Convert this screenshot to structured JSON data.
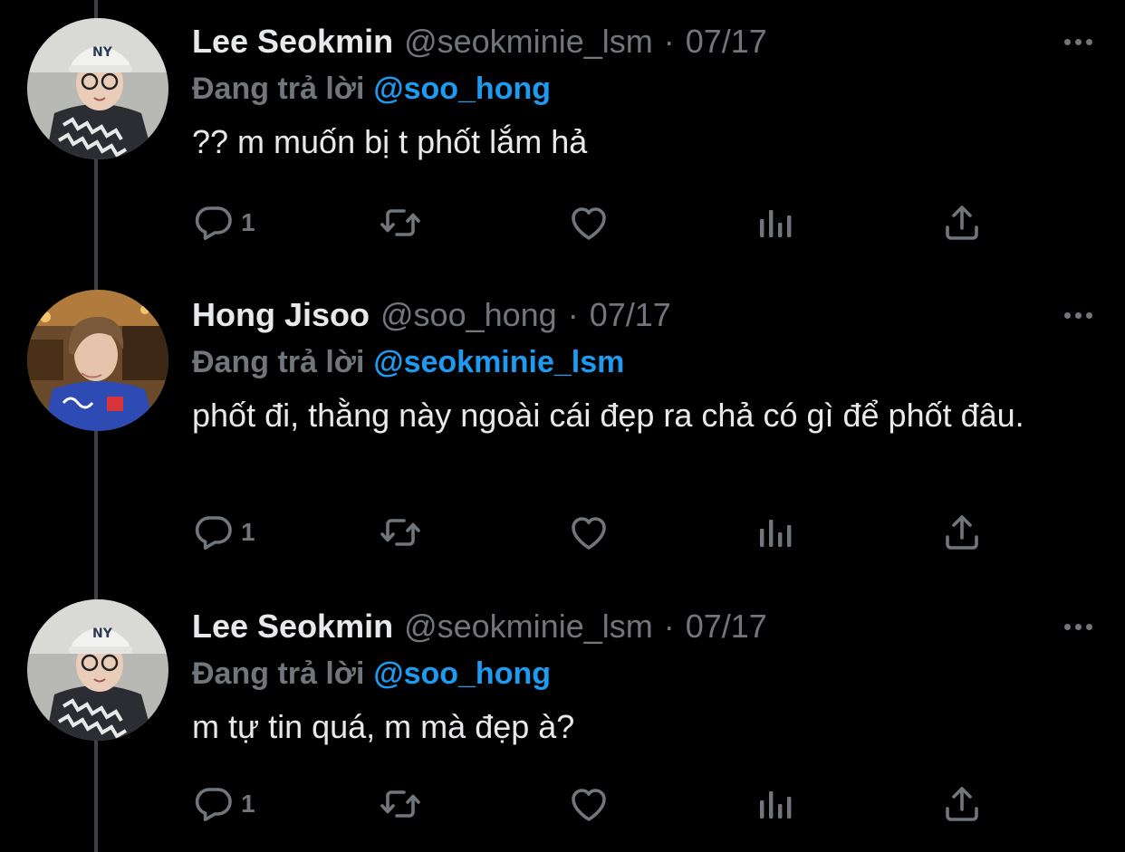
{
  "tweets": [
    {
      "name": "Lee Seokmin",
      "handle": "@seokminie_lsm",
      "separator": "·",
      "date": "07/17",
      "reply_label": "Đang trả lời",
      "reply_to": "@soo_hong",
      "text": "?? m muốn bị t phốt lắm hả",
      "reply_count": "1",
      "avatar": "person-avatar-icon"
    },
    {
      "name": "Hong Jisoo",
      "handle": "@soo_hong",
      "separator": "·",
      "date": "07/17",
      "reply_label": "Đang trả lời",
      "reply_to": "@seokminie_lsm",
      "text": "phốt đi, thằng này ngoài cái đẹp ra chả có gì để phốt đâu.",
      "reply_count": "1",
      "avatar": "person-avatar-icon"
    },
    {
      "name": "Lee Seokmin",
      "handle": "@seokminie_lsm",
      "separator": "·",
      "date": "07/17",
      "reply_label": "Đang trả lời",
      "reply_to": "@soo_hong",
      "text": "m tự tin quá, m mà đẹp à?",
      "reply_count": "1",
      "avatar": "person-avatar-icon"
    }
  ],
  "icons": {
    "reply": "reply-icon",
    "retweet": "retweet-icon",
    "like": "like-icon",
    "views": "views-icon",
    "share": "share-icon",
    "more": "more-icon"
  },
  "colors": {
    "background": "#000000",
    "primary_text": "#e7e9ea",
    "secondary_text": "#71767b",
    "link": "#1d9bf0",
    "thread_line": "#3d4144"
  }
}
